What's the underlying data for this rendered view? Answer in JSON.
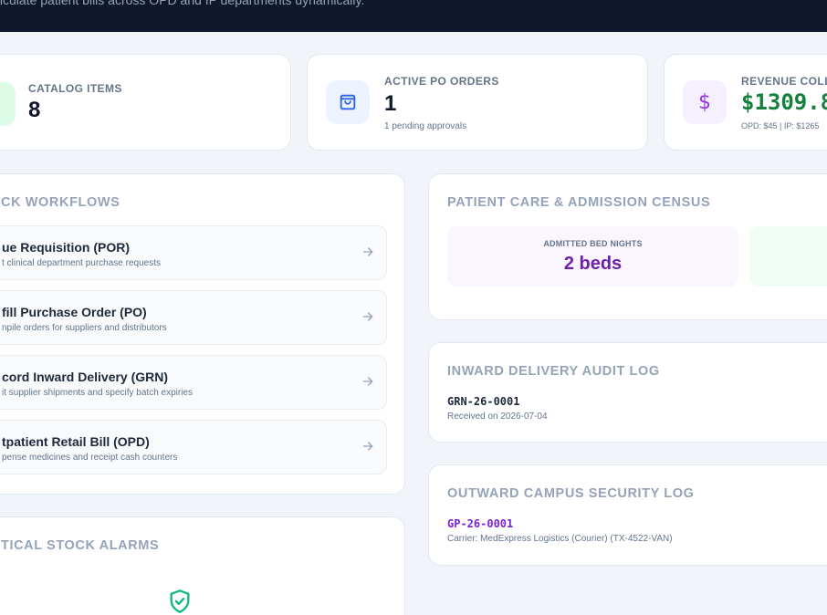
{
  "header": {
    "subtitle": "Calculate patient bills across OPD and IP departments dynamically."
  },
  "stats": {
    "catalog": {
      "label": "CATALOG ITEMS",
      "value": "8"
    },
    "po": {
      "label": "ACTIVE PO ORDERS",
      "value": "1",
      "note": "1 pending approvals"
    },
    "revenue": {
      "label": "REVENUE COLL",
      "value": "$1309.8",
      "note": "OPD: $45 | IP: $1265",
      "currency_symbol": "$"
    }
  },
  "workflows": {
    "title": "CK WORKFLOWS",
    "items": [
      {
        "title": "ue Requisition (POR)",
        "desc": "t clinical department purchase requests"
      },
      {
        "title": "fill Purchase Order (PO)",
        "desc": "npile orders for suppliers and distributors"
      },
      {
        "title": "cord Inward Delivery (GRN)",
        "desc": "it supplier shipments and specify batch expiries"
      },
      {
        "title": "tpatient Retail Bill (OPD)",
        "desc": "pense medicines and receipt cash counters"
      }
    ]
  },
  "alarms": {
    "title": "TICAL STOCK ALARMS"
  },
  "census": {
    "title": "PATIENT CARE & ADMISSION CENSUS",
    "bed_nights_label": "ADMITTED BED NIGHTS",
    "bed_nights_value": "2 beds"
  },
  "inward": {
    "title": "INWARD DELIVERY AUDIT LOG",
    "code": "GRN-26-0001",
    "detail": "Received on 2026-07-04"
  },
  "outward": {
    "title": "OUTWARD CAMPUS SECURITY LOG",
    "code": "GP-26-0001",
    "detail": "Carrier: MedExpress Logistics (Courier) (TX-4522-VAN)"
  },
  "colors": {
    "header_bg": "#0f172a",
    "revenue_green": "#15803d",
    "census_purple": "#6b21a8",
    "outward_purple": "#7e22ce"
  }
}
